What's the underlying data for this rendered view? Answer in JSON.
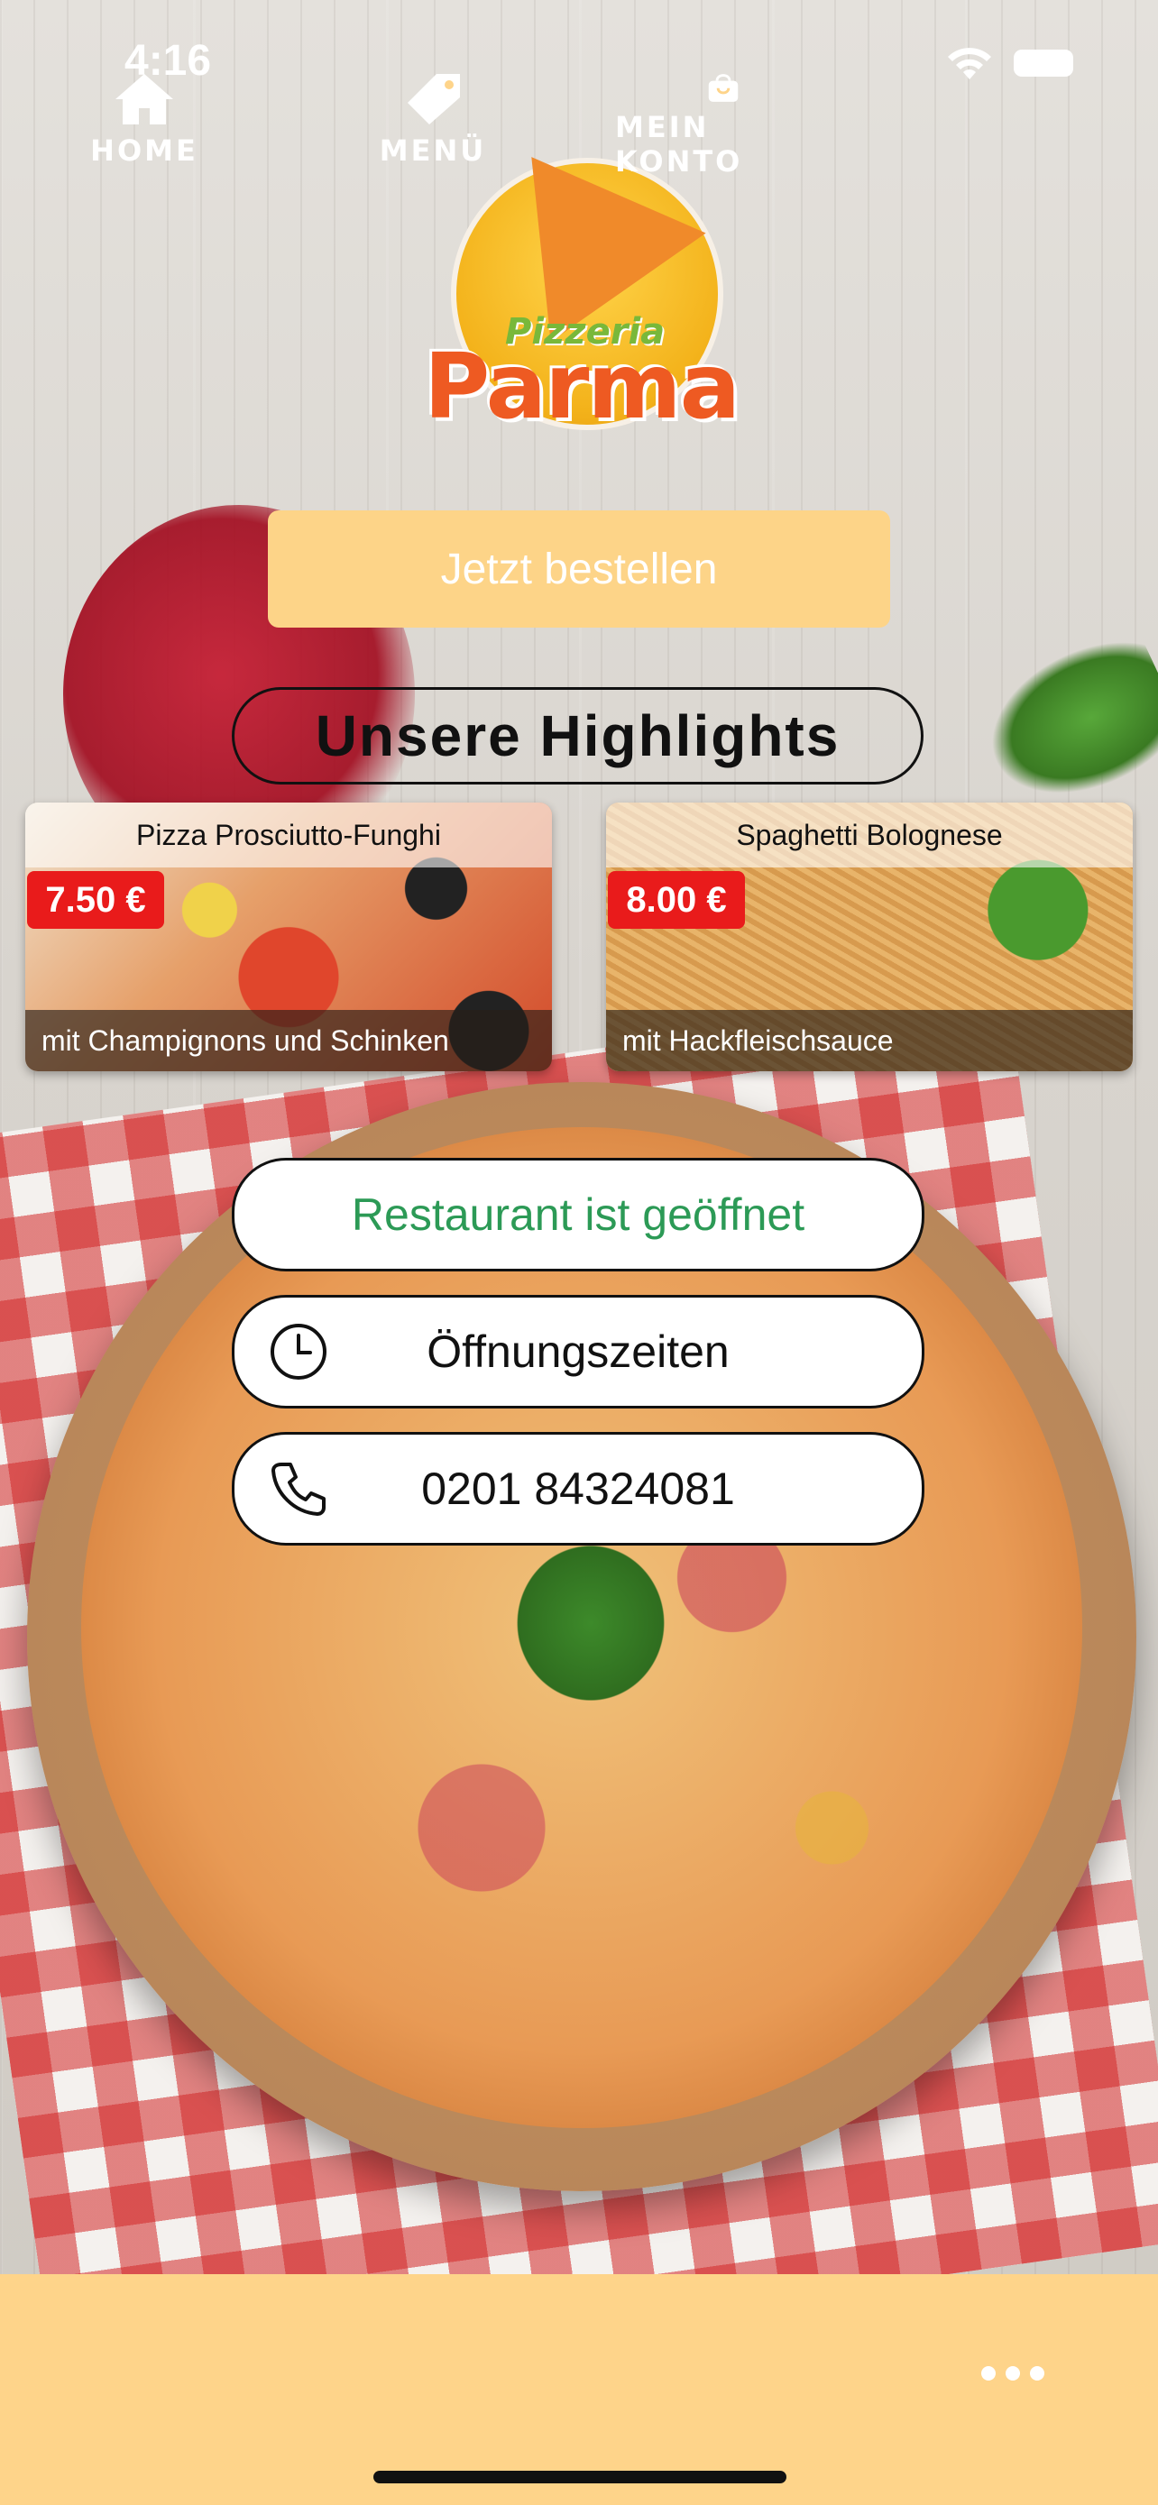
{
  "status_bar": {
    "time": "4:16"
  },
  "brand": {
    "top": "Pizzeria",
    "main": "Parma"
  },
  "order_button": {
    "label": "Jetzt bestellen"
  },
  "highlights": {
    "title": "Unsere Highlights",
    "items": [
      {
        "name": "Pizza Prosciutto-Funghi",
        "price": "7.50 €",
        "description": "mit Champignons und Schinken"
      },
      {
        "name": "Spaghetti Bolognese",
        "price": "8.00 €",
        "description": "mit Hackfleischsauce"
      }
    ]
  },
  "info": {
    "open_status": "Restaurant ist geöffnet",
    "opening_hours_label": "Öffnungszeiten",
    "phone": "0201 84324081"
  },
  "tabbar": {
    "home": "HOME",
    "menu": "MENÜ",
    "account": "MEIN KONTO"
  },
  "colors": {
    "accent": "#fed48a",
    "open_status": "#2c9a56",
    "price_badge": "#e91b1b"
  }
}
